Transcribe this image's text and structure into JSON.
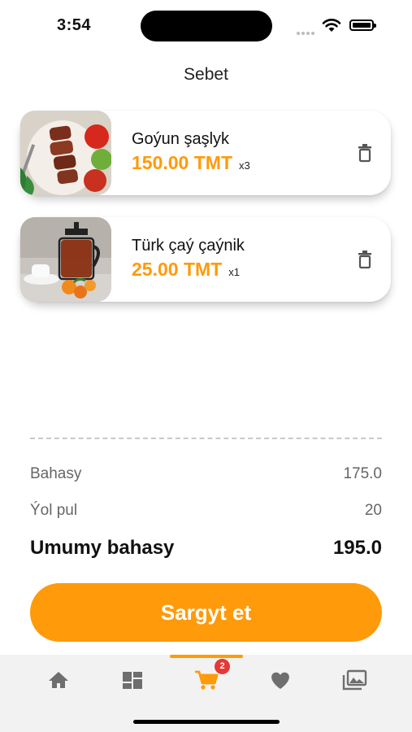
{
  "status_bar": {
    "time": "3:54"
  },
  "header": {
    "title": "Sebet"
  },
  "cart_items": [
    {
      "name": "Goýun şaşlyk",
      "price": "150.00 TMT",
      "qty": "x3"
    },
    {
      "name": "Türk çaý çaýnik",
      "price": "25.00 TMT",
      "qty": "x1"
    }
  ],
  "summary": {
    "subtotal_label": "Bahasy",
    "subtotal_value": "175.0",
    "delivery_label": "Ýol pul",
    "delivery_value": "20",
    "total_label": "Umumy bahasy",
    "total_value": "195.0"
  },
  "checkout_button": {
    "label": "Sargyt et"
  },
  "tab_bar": {
    "tabs": [
      "home-icon",
      "grid-icon",
      "cart-icon",
      "heart-icon",
      "gallery-icon"
    ],
    "active": "cart-icon",
    "cart_badge": "2"
  },
  "colors": {
    "accent": "#ff9a0a",
    "badge": "#e53935",
    "tab_inactive": "#6e6e6e"
  }
}
